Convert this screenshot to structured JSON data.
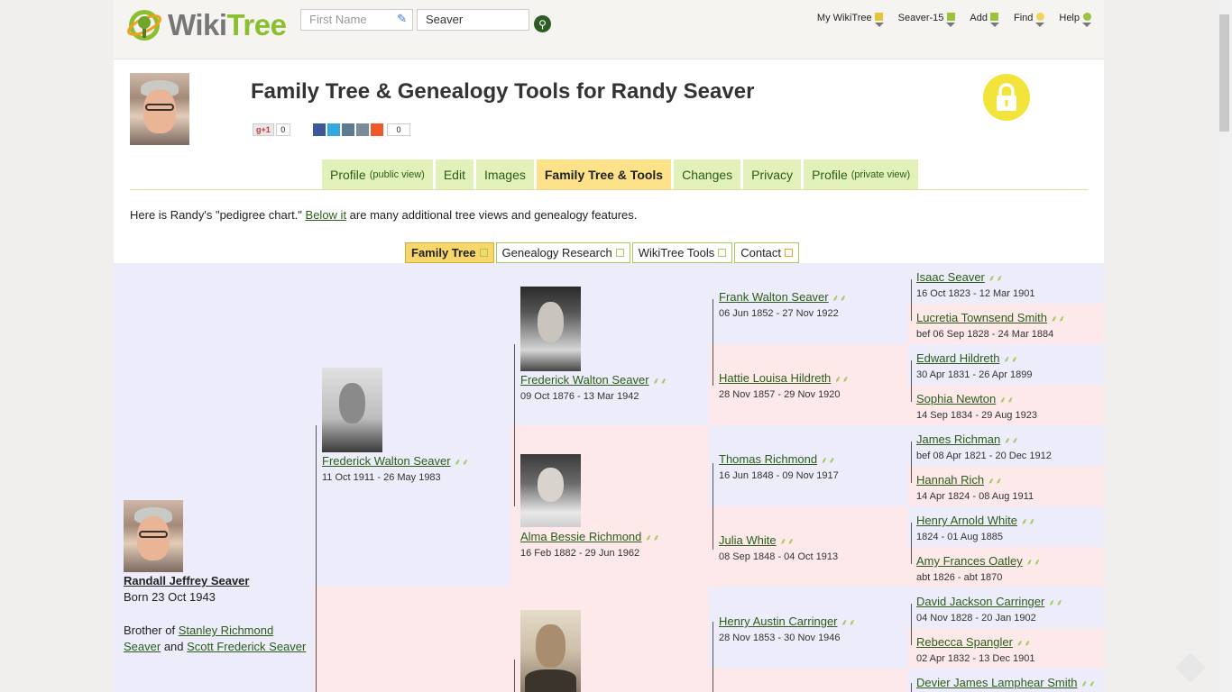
{
  "header": {
    "logo_text_1": "Wiki",
    "logo_text_2": "Tree",
    "first_name_placeholder": "First Name",
    "last_name_value": "Seaver",
    "search_icon": "search-icon",
    "menu": [
      {
        "label": "My WikiTree"
      },
      {
        "label": "Seaver-15"
      },
      {
        "label": "Add"
      },
      {
        "label": "Find"
      },
      {
        "label": "Help"
      }
    ]
  },
  "profile": {
    "title": "Family Tree & Genealogy Tools for Randy Seaver",
    "gplus_label": "g+1",
    "gplus_count": "0",
    "share_count": "0"
  },
  "tabs": [
    {
      "label": "Profile",
      "suffix": "(public view)"
    },
    {
      "label": "Edit",
      "suffix": ""
    },
    {
      "label": "Images",
      "suffix": ""
    },
    {
      "label": "Family Tree & Tools",
      "suffix": ""
    },
    {
      "label": "Changes",
      "suffix": ""
    },
    {
      "label": "Privacy",
      "suffix": ""
    },
    {
      "label": "Profile",
      "suffix": "(private view)"
    }
  ],
  "intro": {
    "before": "Here is Randy's \"pedigree chart.\" ",
    "link": "Below it",
    "after": " are many additional tree views and genealogy features."
  },
  "subtabs": [
    {
      "label": "Family Tree"
    },
    {
      "label": "Genealogy Research"
    },
    {
      "label": "WikiTree Tools"
    },
    {
      "label": "Contact"
    }
  ],
  "root": {
    "name": "Randall Jeffrey Seaver",
    "born": "Born 23 Oct 1943",
    "brother_prefix": "Brother of ",
    "brother1": "Stanley Richmond Seaver",
    "brother_and": " and ",
    "brother2": "Scott Frederick Seaver"
  },
  "gen1": {
    "father": {
      "name": "Frederick Walton Seaver",
      "dates": "11 Oct 1911 - 26 May 1983"
    }
  },
  "gen2": {
    "ff": {
      "name": "Frederick Walton Seaver",
      "dates": "09 Oct 1876 - 13 Mar 1942"
    },
    "fm": {
      "name": "Alma Bessie Richmond",
      "dates": "16 Feb 1882 - 29 Jun 1962"
    }
  },
  "gen3": [
    {
      "name": "Frank Walton Seaver",
      "dates": "06 Jun 1852 - 27 Nov 1922"
    },
    {
      "name": "Hattie Louisa Hildreth",
      "dates": "28 Nov 1857 - 29 Nov 1920"
    },
    {
      "name": "Thomas Richmond",
      "dates": "16 Jun 1848 - 09 Nov 1917"
    },
    {
      "name": "Julia White",
      "dates": "08 Sep 1848 - 04 Oct 1913"
    },
    {
      "name": "Henry Austin Carringer",
      "dates": "28 Nov 1853 - 30 Nov 1946"
    }
  ],
  "gen4": [
    {
      "name": "Isaac Seaver",
      "dates": "16 Oct 1823 - 12 Mar 1901"
    },
    {
      "name": "Lucretia Townsend Smith",
      "dates": "bef 06 Sep 1828 - 24 Mar 1884"
    },
    {
      "name": "Edward Hildreth",
      "dates": "30 Apr 1831 - 26 Apr 1899"
    },
    {
      "name": "Sophia Newton",
      "dates": "14 Sep 1834 - 29 Aug 1923"
    },
    {
      "name": "James Richman",
      "dates": "bef 08 Apr 1821 - 20 Dec 1912"
    },
    {
      "name": "Hannah Rich",
      "dates": "14 Apr 1824 - 08 Aug 1911"
    },
    {
      "name": "Henry Arnold White",
      "dates": "1824 - 01 Aug 1885"
    },
    {
      "name": "Amy Frances Oatley",
      "dates": "abt 1826 - abt 1870"
    },
    {
      "name": "David Jackson Carringer",
      "dates": "04 Nov 1828 - 20 Jan 1902"
    },
    {
      "name": "Rebecca Spangler",
      "dates": "02 Apr 1832 - 13 Dec 1901"
    },
    {
      "name": "Devier James Lamphear Smith",
      "dates": ""
    }
  ],
  "colors": {
    "accent": "#8bbf2e",
    "link": "#2b5d18",
    "tab_bg": "#e2f0b9",
    "tab_active": "#fde28a",
    "male_bg": "#ececfb",
    "female_bg": "#fde9ea"
  }
}
